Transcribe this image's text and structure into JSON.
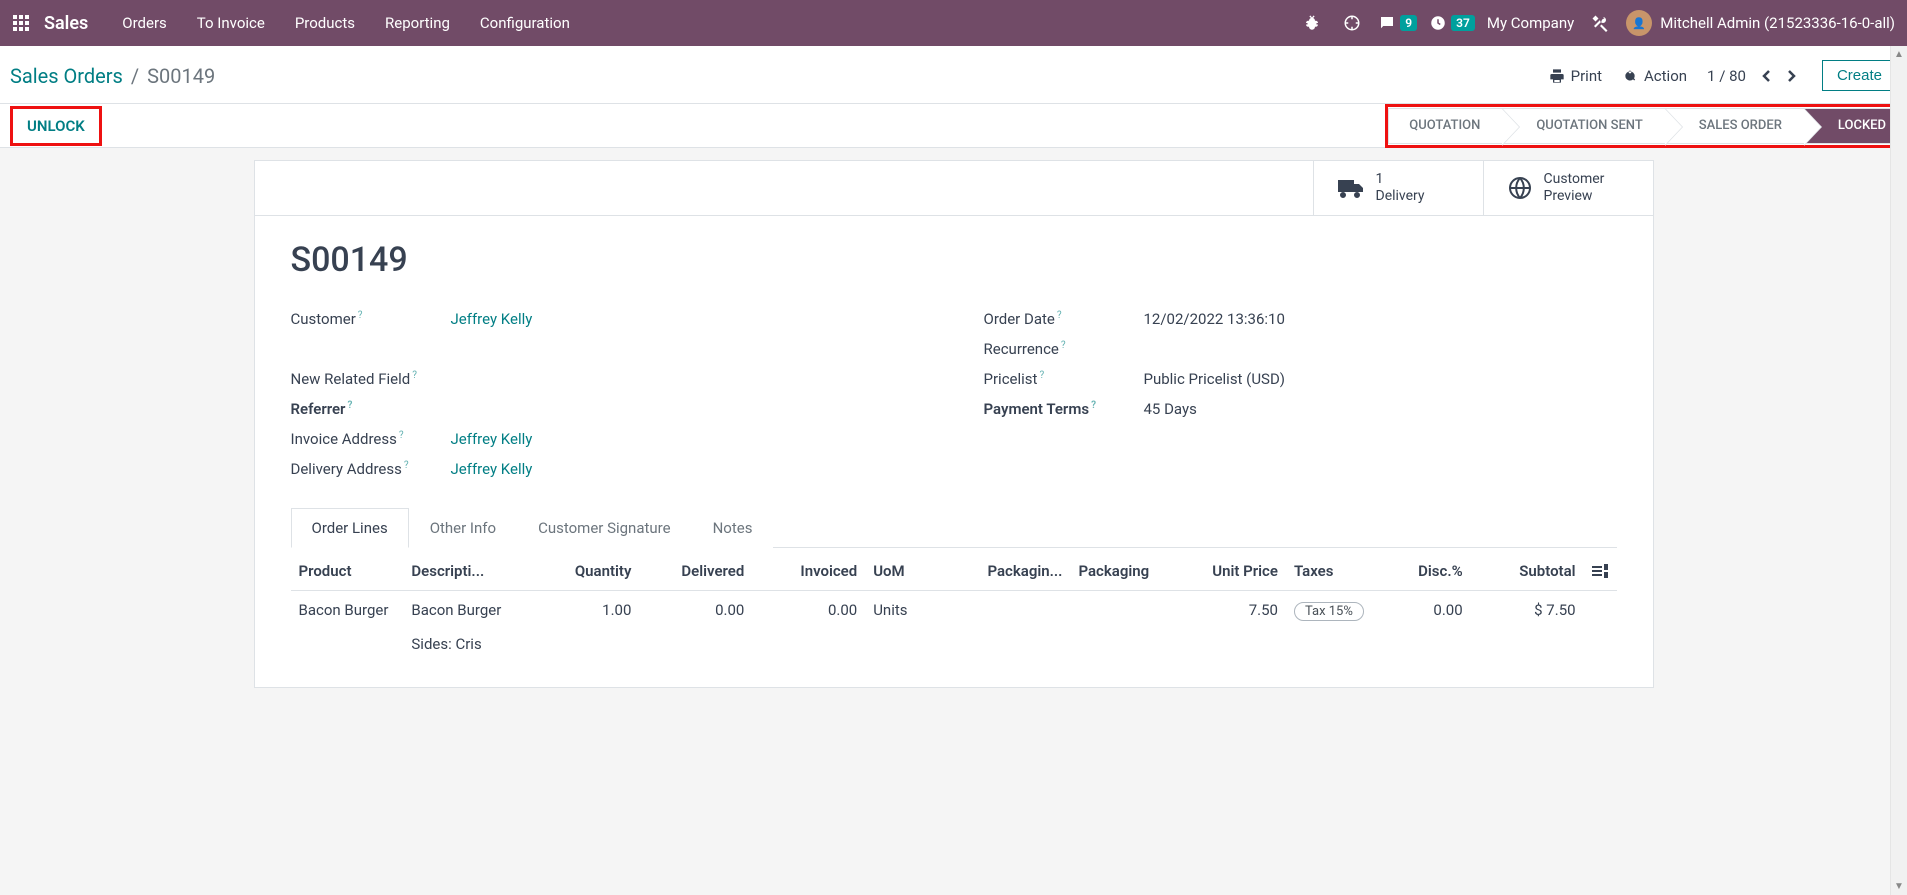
{
  "topbar": {
    "brand": "Sales",
    "menu": [
      "Orders",
      "To Invoice",
      "Products",
      "Reporting",
      "Configuration"
    ],
    "messages_count": "9",
    "activities_count": "37",
    "company": "My Company",
    "username": "Mitchell Admin (21523336-16-0-all)"
  },
  "actionbar": {
    "breadcrumb_link": "Sales Orders",
    "breadcrumb_current": "S00149",
    "print": "Print",
    "action": "Action",
    "pager": "1 / 80",
    "create": "Create"
  },
  "statusbar": {
    "unlock": "UNLOCK",
    "stages": [
      "QUOTATION",
      "QUOTATION SENT",
      "SALES ORDER",
      "LOCKED"
    ]
  },
  "stat_buttons": {
    "delivery_count": "1",
    "delivery_label": "Delivery",
    "preview_l1": "Customer",
    "preview_l2": "Preview"
  },
  "form": {
    "title": "S00149",
    "left": {
      "customer_label": "Customer",
      "customer_value": "Jeffrey Kelly",
      "new_related_label": "New Related Field",
      "referrer_label": "Referrer",
      "invoice_addr_label": "Invoice Address",
      "invoice_addr_value": "Jeffrey Kelly",
      "delivery_addr_label": "Delivery Address",
      "delivery_addr_value": "Jeffrey Kelly"
    },
    "right": {
      "order_date_label": "Order Date",
      "order_date_value": "12/02/2022 13:36:10",
      "recurrence_label": "Recurrence",
      "pricelist_label": "Pricelist",
      "pricelist_value": "Public Pricelist (USD)",
      "payment_terms_label": "Payment Terms",
      "payment_terms_value": "45 Days"
    }
  },
  "tabs": [
    "Order Lines",
    "Other Info",
    "Customer Signature",
    "Notes"
  ],
  "table": {
    "headers": {
      "product": "Product",
      "description": "Descripti...",
      "quantity": "Quantity",
      "delivered": "Delivered",
      "invoiced": "Invoiced",
      "uom": "UoM",
      "packaging1": "Packagin...",
      "packaging2": "Packaging",
      "unit_price": "Unit Price",
      "taxes": "Taxes",
      "disc": "Disc.%",
      "subtotal": "Subtotal"
    },
    "rows": [
      {
        "product": "Bacon Burger",
        "description_l1": "Bacon Burger",
        "description_l2": "Sides: Cris",
        "quantity": "1.00",
        "delivered": "0.00",
        "invoiced": "0.00",
        "uom": "Units",
        "packaging1": "",
        "packaging2": "",
        "unit_price": "7.50",
        "tax": "Tax 15%",
        "disc": "0.00",
        "subtotal": "$ 7.50"
      }
    ]
  }
}
